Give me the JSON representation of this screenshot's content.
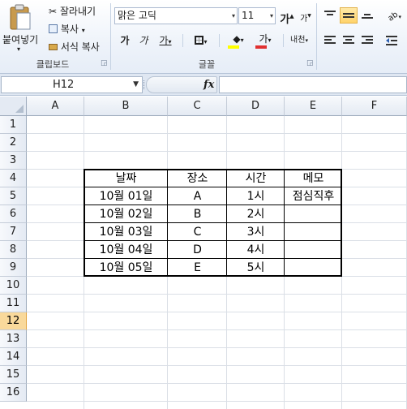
{
  "ribbon": {
    "clipboard": {
      "paste_label": "붙여넣기",
      "cut_label": "잘라내기",
      "copy_label": "복사",
      "format_painter_label": "서식 복사",
      "group_label": "클립보드"
    },
    "font": {
      "font_name": "맑은 고딕",
      "font_size": "11",
      "grow_font": "가",
      "shrink_font": "가",
      "bold": "가",
      "italic": "가",
      "underline": "가",
      "font_color_glyph": "가",
      "phonetic_glyph": "내천",
      "group_label": "글꼴",
      "font_color": "#e03030",
      "fill_color": "#ffff00"
    }
  },
  "formula_bar": {
    "name_box_value": "H12",
    "fx_label": "fx",
    "formula_value": ""
  },
  "sheet": {
    "columns": [
      "A",
      "B",
      "C",
      "D",
      "E",
      "F"
    ],
    "rows": [
      "1",
      "2",
      "3",
      "4",
      "5",
      "6",
      "7",
      "8",
      "9",
      "10",
      "11",
      "12",
      "13",
      "14",
      "15",
      "16"
    ],
    "active_row": "12",
    "table": {
      "headers": [
        "날짜",
        "장소",
        "시간",
        "메모"
      ],
      "rows": [
        [
          "10월 01일",
          "A",
          "1시",
          "점심직후"
        ],
        [
          "10월 02일",
          "B",
          "2시",
          ""
        ],
        [
          "10월 03일",
          "C",
          "3시",
          ""
        ],
        [
          "10월 04일",
          "D",
          "4시",
          ""
        ],
        [
          "10월 05일",
          "E",
          "5시",
          ""
        ]
      ]
    }
  }
}
